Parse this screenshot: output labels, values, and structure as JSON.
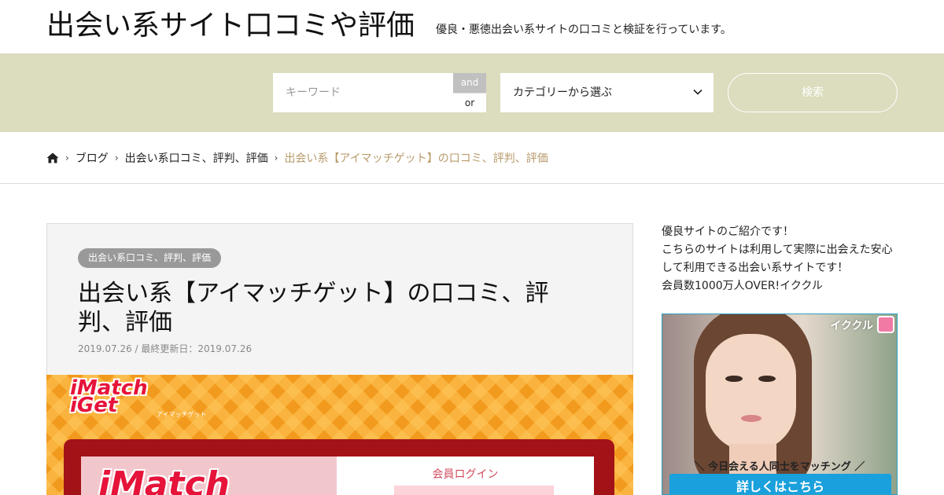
{
  "header": {
    "site_title": "出会い系サイト口コミや評価",
    "site_description": "優良・悪徳出会い系サイトの口コミと検証を行っています。"
  },
  "search": {
    "keyword_placeholder": "キーワード",
    "and_label": "and",
    "or_label": "or",
    "category_selected": "カテゴリーから選ぶ",
    "button_label": "検索",
    "band_color": "#dcdcbe"
  },
  "breadcrumb": {
    "home_icon": "home-icon",
    "items": [
      {
        "label": "ブログ"
      },
      {
        "label": "出会い系口コミ、評判、評価"
      },
      {
        "label": "出会い系【アイマッチゲット】の口コミ、評判、評価"
      }
    ],
    "current_color": "#b89a6a"
  },
  "article": {
    "category": "出会い系口コミ、評判、評価",
    "title": "出会い系【アイマッチゲット】の口コミ、評判、評価",
    "date_line": "2019.07.26 / 最終更新日：2019.07.26",
    "eyecatch": {
      "logo": "iMatch iGet",
      "logo_sub": "アイマッチゲット",
      "login_title": "会員ログイン",
      "big_logo": "iMatch"
    }
  },
  "sidebar": {
    "intro_lines": [
      "優良サイトのご紹介です！",
      "こちらのサイトは利用して実際に出会えた安心",
      "して利用できる出会い系サイトです！",
      "会員数1000万人OVER!イククル"
    ],
    "banner": {
      "brand": "イククル",
      "catch": "＼ 今日会える人同士をマッチング ／",
      "cta": "詳しくはこちら",
      "cta_color": "#1aa0dc"
    }
  }
}
